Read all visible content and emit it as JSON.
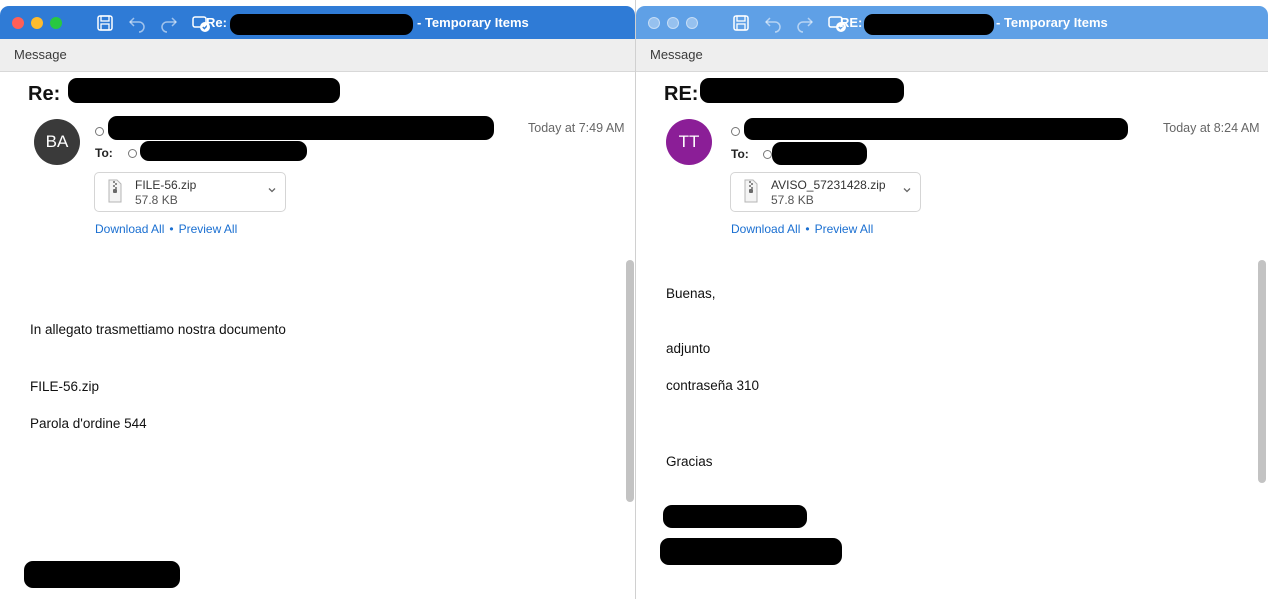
{
  "left": {
    "title": {
      "prefix": "Re:",
      "suffix": "- Temporary Items"
    },
    "toolbar_tab": "Message",
    "subject_prefix": "Re:",
    "avatar_initials": "BA",
    "to_label": "To:",
    "date": "Today at 7:49 AM",
    "attachment": {
      "name": "FILE-56.zip",
      "size": "57.8 KB"
    },
    "links": {
      "download_all": "Download All",
      "separator": "•",
      "preview_all": "Preview All"
    },
    "body_lines": [
      "In allegato trasmettiamo nostra documento",
      "FILE-56.zip",
      "Parola d'ordine 544"
    ]
  },
  "right": {
    "title": {
      "prefix": "RE:",
      "suffix": "- Temporary Items"
    },
    "toolbar_tab": "Message",
    "subject_prefix": "RE:",
    "avatar_initials": "TT",
    "to_label": "To:",
    "date": "Today at 8:24 AM",
    "attachment": {
      "name": "AVISO_57231428.zip",
      "size": "57.8 KB"
    },
    "links": {
      "download_all": "Download All",
      "separator": "•",
      "preview_all": "Preview All"
    },
    "body_lines": [
      "Buenas,",
      "adjunto",
      "contraseña 310",
      "Gracias"
    ]
  },
  "icons": [
    "save-icon",
    "undo-icon",
    "redo-icon",
    "rules-icon",
    "zip-file-icon",
    "chevron-down-icon"
  ],
  "colors": {
    "titlebar_active": "#2f7bd6",
    "titlebar_inactive": "#5fa0e6",
    "avatar_ba": "#3a3a3a",
    "avatar_tt": "#8b1e97",
    "link": "#1a6fd1",
    "redaction": "#000000"
  }
}
